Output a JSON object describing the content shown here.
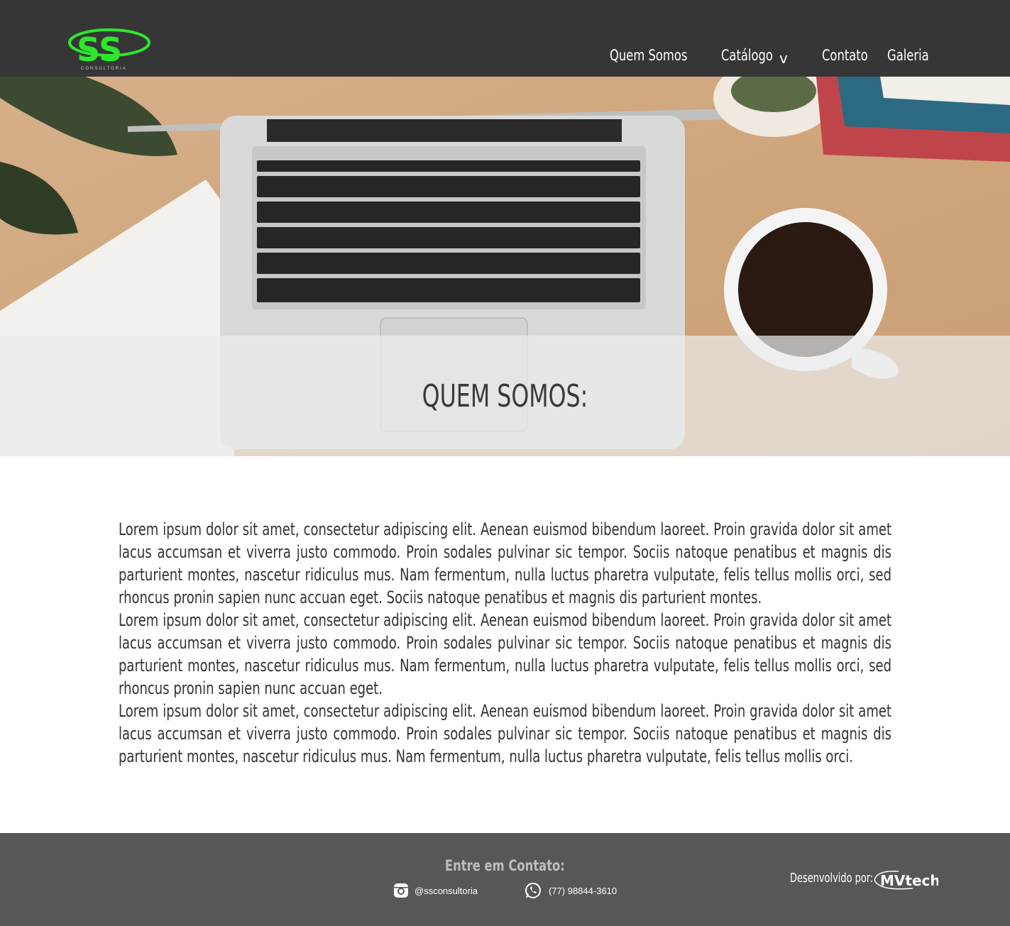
{
  "header": {
    "logo_alt": "SS Consultoria",
    "logo_text": "SS",
    "logo_tagline": "CONSULTORIA",
    "nav": [
      {
        "label": "Quem Somos"
      },
      {
        "label": "Catálogo"
      },
      {
        "label": "Contato"
      },
      {
        "label": "Galeria"
      }
    ],
    "catalog_chevron": "v"
  },
  "hero": {
    "title": "QUEM SOMOS:"
  },
  "main": {
    "paragraphs": [
      "Lorem ipsum dolor sit amet, consectetur adipiscing elit. Aenean euismod bibendum laoreet. Proin gravida dolor sit amet lacus accumsan et viverra justo commodo. Proin sodales pulvinar sic tempor. Sociis natoque penatibus et magnis dis parturient montes, nascetur ridiculus mus. Nam fermentum, nulla luctus pharetra vulputate, felis tellus mollis orci, sed rhoncus pronin sapien nunc accuan eget. Sociis natoque penatibus et magnis dis parturient montes.",
      "Lorem ipsum dolor sit amet, consectetur adipiscing elit. Aenean euismod bibendum laoreet. Proin gravida dolor sit amet lacus accumsan et viverra justo commodo. Proin sodales pulvinar sic tempor. Sociis natoque penatibus et magnis dis parturient montes, nascetur ridiculus mus. Nam fermentum, nulla luctus pharetra vulputate, felis tellus mollis orci, sed rhoncus pronin sapien nunc accuan eget.",
      "Lorem ipsum dolor sit amet, consectetur adipiscing elit. Aenean euismod bibendum laoreet. Proin gravida dolor sit amet lacus accumsan et viverra justo commodo. Proin sodales pulvinar sic tempor. Sociis natoque penatibus et magnis dis parturient montes, nascetur ridiculus mus. Nam fermentum, nulla luctus pharetra vulputate, felis tellus mollis orci."
    ]
  },
  "footer": {
    "contact_title": "Entre em Contato:",
    "instagram": {
      "icon": "instagram-icon",
      "handle": "@ssconsultoria"
    },
    "whatsapp": {
      "icon": "whatsapp-icon",
      "phone": "(77) 98844-3610"
    },
    "developed_by": "Desenvolvido por:",
    "developer_logo": "MVtech"
  },
  "colors": {
    "header_bg": "#363636",
    "footer_bg": "#575757",
    "logo_green": "#2ee62e",
    "text": "#333333"
  }
}
